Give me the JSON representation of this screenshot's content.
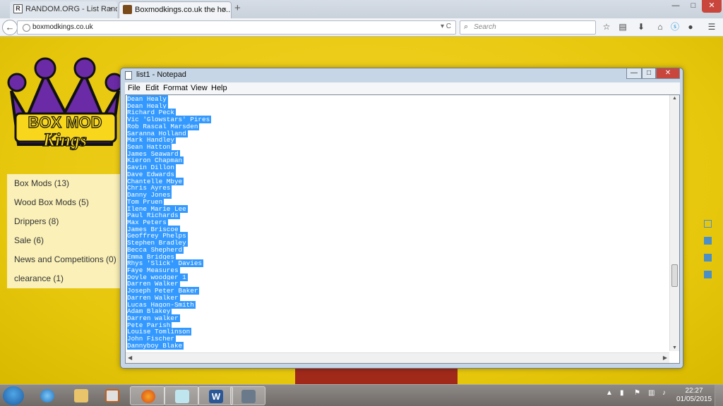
{
  "browser": {
    "tabs": [
      {
        "label": "RANDOM.ORG - List Rand...",
        "close": "×",
        "state": "inactive"
      },
      {
        "label": "Boxmodkings.co.uk the ho...",
        "close": "×",
        "state": "active"
      }
    ],
    "new_tab": "+",
    "window_buttons": {
      "minimize": "—",
      "maximize": "□",
      "close": "✕"
    },
    "url": "boxmodkings.co.uk",
    "url_controls": "▾ C",
    "search_placeholder": "Search",
    "back_glyph": "←"
  },
  "site": {
    "logo_line1": "BOX MOD",
    "logo_line2": "Kings",
    "menu": [
      {
        "label": "Box Mods (13)"
      },
      {
        "label": "Wood Box Mods (5)"
      },
      {
        "label": "Drippers (8)"
      },
      {
        "label": "Sale (6)"
      },
      {
        "label": "News and Competitions (0)"
      },
      {
        "label": "clearance (1)"
      }
    ],
    "colors": {
      "background": "#e7c70c",
      "menu_bg": "#faf0b8",
      "crown_purple": "#6b2aa6",
      "banner": "#a0291a"
    }
  },
  "notepad": {
    "title": "list1 - Notepad",
    "menu": [
      "File",
      "Edit",
      "Format",
      "View",
      "Help"
    ],
    "selection_color": "#3399ff",
    "lines": [
      "Dean Healy",
      "Dean Healy",
      "Richard Peck",
      "Vic 'Glowstars' Pires",
      "Rob Rascal Marsden",
      "Saranna Holland",
      "Mark Handley",
      "Sean Hatton",
      "James Seaward",
      "Kieron Chapman",
      "Gavin Dillon",
      "Dave Edwards",
      "Chantelle Mbye",
      "Chris Ayres",
      "Danny Jones",
      "Tom Pruen",
      "Ilene Marie Lee",
      "Paul Richards",
      "Max Peters",
      "James Briscoe",
      "Geoffrey Phelps",
      "Stephen Bradley",
      "Becca Shepherd",
      "Emma Bridges",
      "Rhys 'Slick' Davies",
      "Faye Measures",
      "Doyle woodger 1",
      "Darren Walker",
      "Joseph Peter Baker",
      "Darren Walker",
      "Lucas Hagon-Smith",
      "Adam Blakey",
      "Darren walker",
      "Pete Parish",
      "Louise Tomlinson",
      "John Fischer",
      "Dannyboy Blake"
    ]
  },
  "taskbar": {
    "apps": [
      "start",
      "internet-explorer",
      "file-explorer",
      "media-player",
      "firefox",
      "notepad",
      "word",
      "recorder"
    ],
    "clock_time": "22:27",
    "clock_date": "01/05/2015"
  }
}
